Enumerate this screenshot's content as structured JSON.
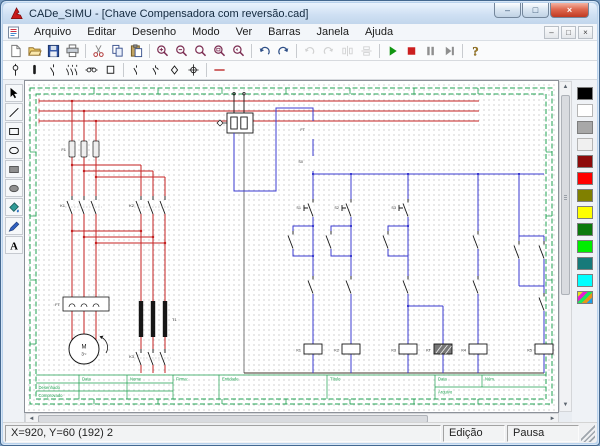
{
  "window": {
    "title": "CADe_SIMU - [Chave Compensadora com reversão.cad]",
    "controls": {
      "minimize": "–",
      "maximize": "□",
      "close": "×"
    }
  },
  "menu": {
    "items": [
      "Arquivo",
      "Editar",
      "Desenho",
      "Modo",
      "Ver",
      "Barras",
      "Janela",
      "Ajuda"
    ],
    "mdi_controls": [
      {
        "name": "mdi-minimize",
        "glyph": "–"
      },
      {
        "name": "mdi-restore",
        "glyph": "□"
      },
      {
        "name": "mdi-close",
        "glyph": "×"
      }
    ]
  },
  "toolbar_main": [
    {
      "icon": "new"
    },
    {
      "icon": "open"
    },
    {
      "icon": "save"
    },
    {
      "icon": "print"
    },
    {
      "sep": true
    },
    {
      "icon": "cut"
    },
    {
      "icon": "copy"
    },
    {
      "icon": "paste"
    },
    {
      "sep": true
    },
    {
      "icon": "zoom-in"
    },
    {
      "icon": "zoom-out"
    },
    {
      "icon": "zoom"
    },
    {
      "icon": "zoom-window"
    },
    {
      "icon": "zoom-previous"
    },
    {
      "sep": true
    },
    {
      "icon": "undo"
    },
    {
      "icon": "redo"
    },
    {
      "sep": true
    },
    {
      "icon": "rotate-left",
      "disabled": true
    },
    {
      "icon": "rotate-right",
      "disabled": true
    },
    {
      "icon": "flip-horizontal",
      "disabled": true
    },
    {
      "icon": "flip-vertical",
      "disabled": true
    },
    {
      "sep": true
    },
    {
      "icon": "simulate-play"
    },
    {
      "icon": "simulate-stop"
    },
    {
      "icon": "simulate-pause"
    },
    {
      "icon": "simulate-step"
    },
    {
      "sep": true
    },
    {
      "icon": "help"
    }
  ],
  "toolbar_symbols": [
    {
      "icon": "sym-pole"
    },
    {
      "icon": "sym-fuse"
    },
    {
      "icon": "sym-contact"
    },
    {
      "icon": "sym-contact-triple"
    },
    {
      "icon": "sym-coil"
    },
    {
      "icon": "sym-box"
    },
    {
      "sep": true
    },
    {
      "icon": "sym-contact-small"
    },
    {
      "icon": "sym-changeover"
    },
    {
      "icon": "sym-diamond"
    },
    {
      "icon": "sym-terminal"
    },
    {
      "sep": true
    },
    {
      "icon": "sym-wire"
    }
  ],
  "tool_palette": [
    {
      "icon": "select"
    },
    {
      "icon": "line"
    },
    {
      "icon": "rectangle"
    },
    {
      "icon": "ellipse"
    },
    {
      "icon": "rectangle-filled"
    },
    {
      "icon": "ellipse-filled"
    },
    {
      "icon": "fill"
    },
    {
      "icon": "brush"
    },
    {
      "icon": "text"
    }
  ],
  "color_palette": [
    "#000000",
    "#ffffff",
    "#a8a8a8",
    "#f0f0f0",
    "#8e0b0b",
    "#ff0000",
    "#808000",
    "#ffff00",
    "#0c7a0c",
    "#00ee00",
    "#177a7a",
    "#00ffff"
  ],
  "scrollbars": {
    "up": "▲",
    "down": "▼",
    "left": "◄",
    "right": "►"
  },
  "canvas": {
    "labels": {
      "fuses": "F1",
      "contactor_left": "K1",
      "contactor_right": "K2",
      "overload_relay": "FT",
      "motor": "M",
      "motor_phases": "3~",
      "transformer": "T1",
      "contactor_star": "K3",
      "control_overload": "FT",
      "stop_button": "S0",
      "start_button_1": "S1",
      "start_button_2": "S2",
      "start_button_3": "S3"
    },
    "coil_labels": [
      "K1",
      "K2",
      "K3",
      "KT",
      "K4",
      "K5"
    ],
    "title_block": {
      "drawn": "Desenhado",
      "checked": "Comprovado",
      "date": "Data",
      "name": "Nome",
      "firm": "Firma:",
      "entity": "Entidade",
      "title": "Título",
      "date2": "Data",
      "number": "Núm.",
      "file": "Arquivo"
    }
  },
  "status_bar": {
    "coordinates": "X=920, Y=60 (192) 2",
    "mode": "Edição",
    "simulation": "Pausa"
  }
}
